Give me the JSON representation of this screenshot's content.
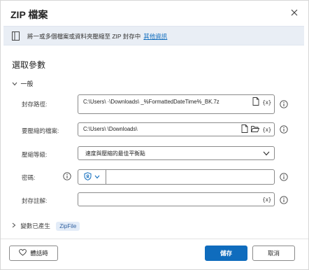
{
  "dialog": {
    "title": "ZIP 檔案"
  },
  "banner": {
    "text": "將一或多個檔案或資料夾壓縮至 ZIP 封存中",
    "link": "其他資訊"
  },
  "section_title": "選取參數",
  "group": {
    "label": "一般"
  },
  "fields": {
    "archive_path": {
      "label": "封存路徑:",
      "value": "C:\\Users\\            ·\\Downloads\\          _%FormattedDateTime%_BK.7z"
    },
    "files_to_zip": {
      "label": "要壓縮的檔案:",
      "value": "C:\\Users\\               \\Downloads\\"
    },
    "compression_level": {
      "label": "壓縮等級:",
      "value": "速度與壓縮的最佳平衡點"
    },
    "password": {
      "label": "密碼:",
      "value": ""
    },
    "archive_comment": {
      "label": "封存註解:",
      "value": ""
    }
  },
  "variables": {
    "label": "變數已產生",
    "badge": "ZipFile"
  },
  "footer": {
    "feedback_label": "體話時",
    "save_label": "儲存",
    "cancel_label": "取消"
  },
  "tokens": {
    "variable": "{x}"
  },
  "colors": {
    "accent": "#0f6cbd",
    "banner_bg": "#e9eef5",
    "badge_bg": "#e3ecf8"
  },
  "icons": [
    "close-icon",
    "info-banner-icon",
    "file-icon",
    "folder-open-icon",
    "variable-icon",
    "info-icon",
    "chevron-down-icon",
    "shield-icon",
    "heart-icon"
  ]
}
